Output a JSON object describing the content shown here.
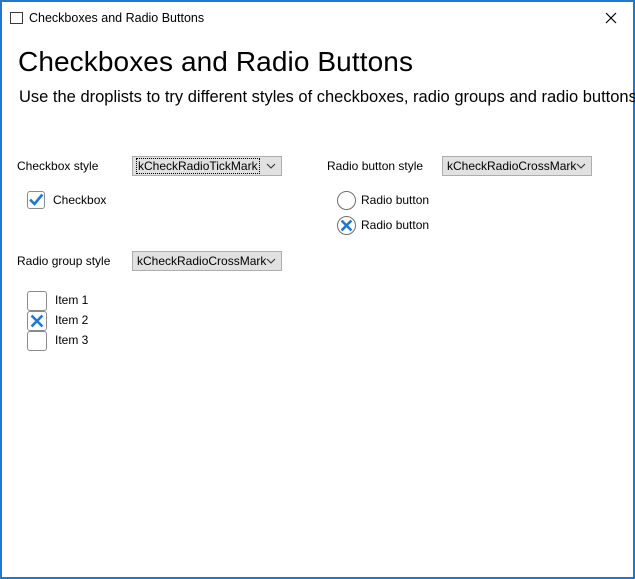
{
  "window": {
    "title": "Checkboxes and Radio Buttons",
    "close_icon": "close-icon",
    "accent_color": "#1f79d1"
  },
  "header": {
    "title": "Checkboxes and Radio Buttons",
    "subtitle": "Use the droplists to try different styles of checkboxes, radio groups and radio buttons."
  },
  "checkbox_section": {
    "label": "Checkbox style",
    "dropdown_value": "kCheckRadioTickMark",
    "checkbox": {
      "label": "Checkbox",
      "checked": true,
      "mark": "tick"
    }
  },
  "radio_button_section": {
    "label": "Radio button style",
    "dropdown_value": "kCheckRadioCrossMark",
    "buttons": [
      {
        "label": "Radio button",
        "selected": false
      },
      {
        "label": "Radio button",
        "selected": true,
        "mark": "cross"
      }
    ]
  },
  "radio_group_section": {
    "label": "Radio group style",
    "dropdown_value": "kCheckRadioCrossMark",
    "items": [
      {
        "label": "Item 1",
        "selected": false
      },
      {
        "label": "Item 2",
        "selected": true,
        "mark": "cross"
      },
      {
        "label": "Item 3",
        "selected": false
      }
    ]
  }
}
